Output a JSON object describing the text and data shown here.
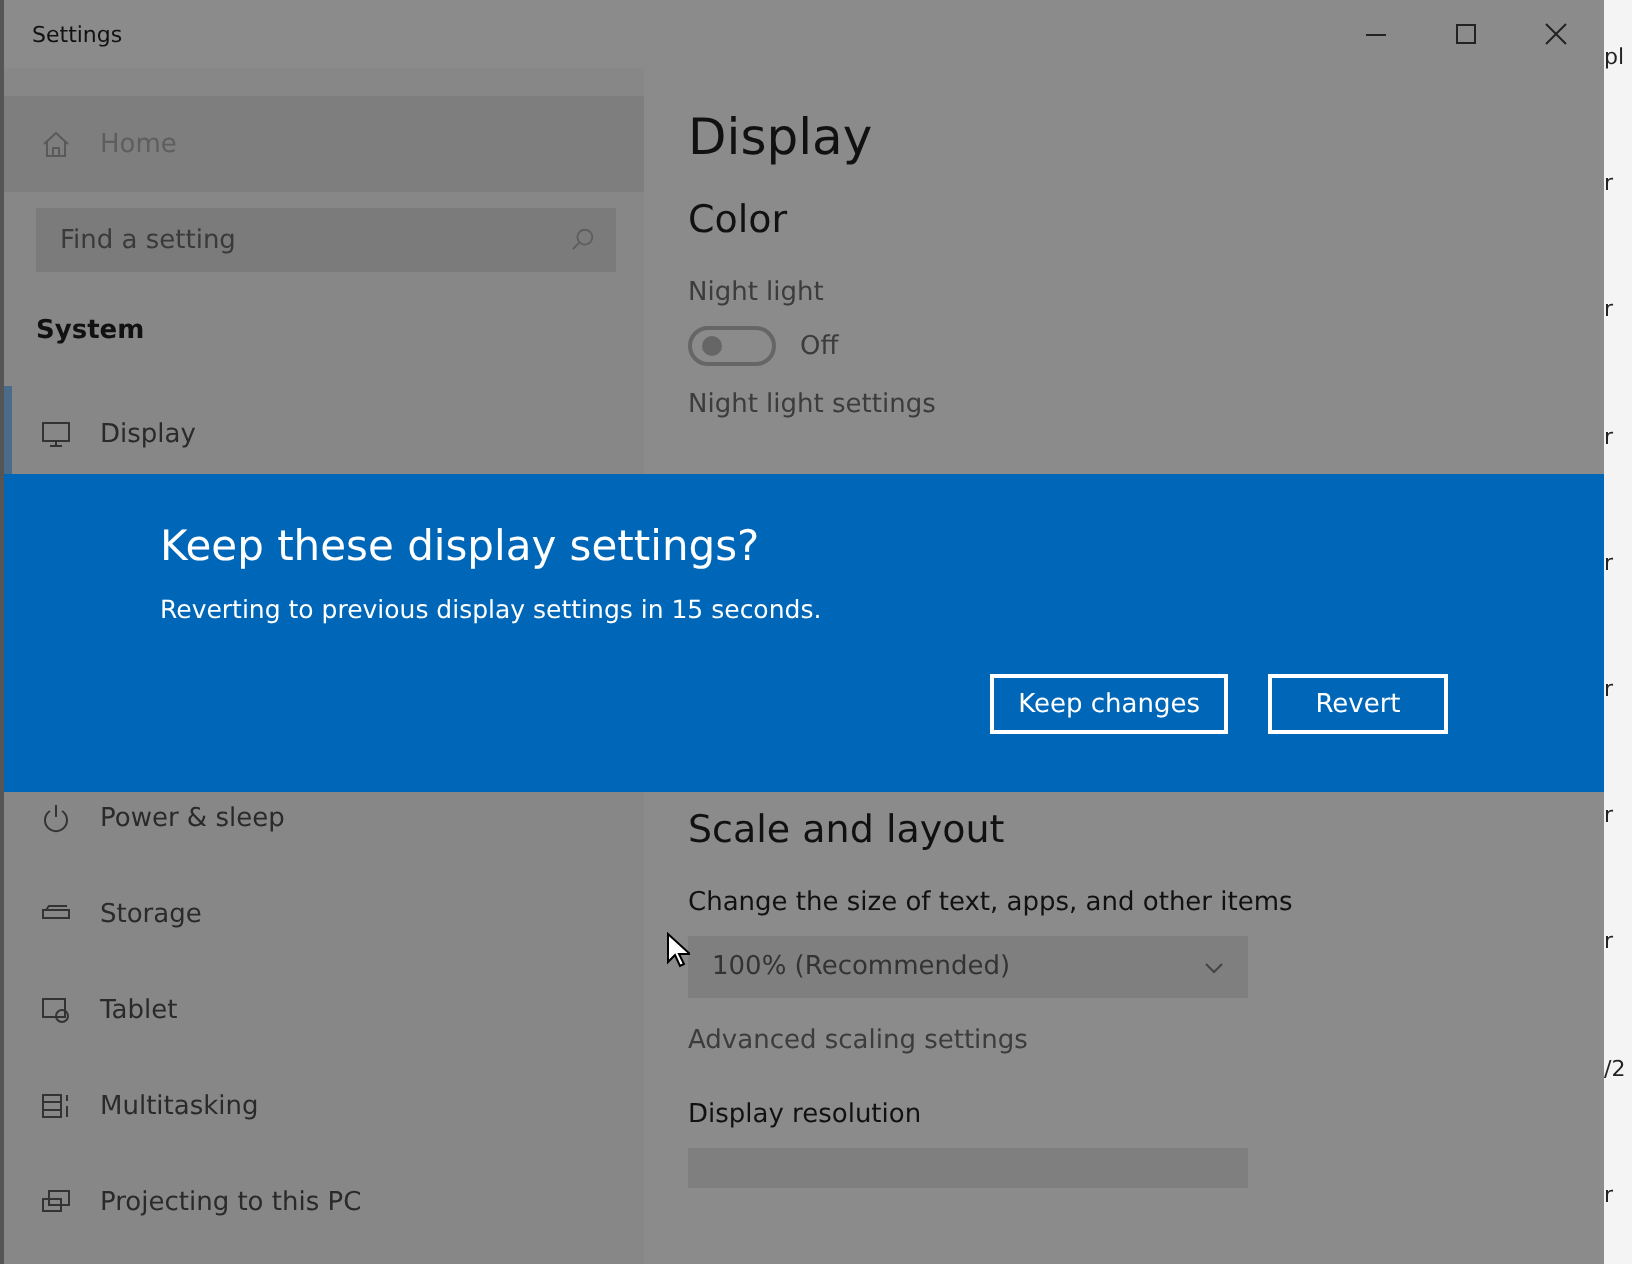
{
  "window": {
    "title": "Settings"
  },
  "sidebar": {
    "home": {
      "label": "Home"
    },
    "search": {
      "placeholder": "Find a setting"
    },
    "section": "System",
    "items": [
      {
        "label": "Display",
        "kind": "monitor",
        "selected": true
      },
      {
        "label": "Power & sleep",
        "kind": "power",
        "selected": false
      },
      {
        "label": "Storage",
        "kind": "drive",
        "selected": false
      },
      {
        "label": "Tablet",
        "kind": "tablet",
        "selected": false
      },
      {
        "label": "Multitasking",
        "kind": "multitask",
        "selected": false
      },
      {
        "label": "Projecting to this PC",
        "kind": "project",
        "selected": false
      }
    ]
  },
  "main": {
    "title": "Display",
    "color_heading": "Color",
    "night_light": {
      "label": "Night light",
      "on": false,
      "state_text": "Off"
    },
    "night_light_link": "Night light settings",
    "scale_heading": "Scale and layout",
    "scale_label": "Change the size of text, apps, and other items",
    "scale_value": "100% (Recommended)",
    "advanced_link": "Advanced scaling settings",
    "resolution_label": "Display resolution"
  },
  "dialog": {
    "title": "Keep these display settings?",
    "message": "Reverting to previous display settings in 15 seconds.",
    "buttons": [
      {
        "label": "Keep changes"
      },
      {
        "label": "Revert"
      }
    ]
  },
  "background_window": {
    "fragments": [
      "pl",
      "r",
      "r",
      "r",
      "r",
      "r",
      "r",
      "r",
      "/2",
      "r"
    ]
  }
}
